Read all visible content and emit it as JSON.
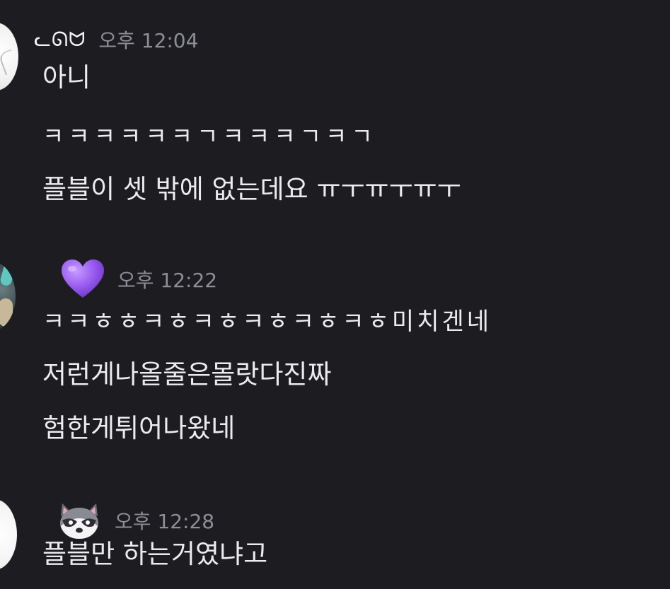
{
  "messages": [
    {
      "author": "ᓚᘏᗢ",
      "time": "오후 12:04",
      "lines": [
        "아니",
        "ㅋㅋㅋㅋㅋㅋㄱㅋㅋㅋㄱㅋㄱ",
        "플블이 셋 밖에 없는데요 ㅠㅜㅠㅜㅠㅜ"
      ]
    },
    {
      "author_icon": "purple-heart-icon",
      "time": "오후 12:22",
      "lines": [
        "ㅋㅋㅎㅎㅋㅎㅋㅎㅋㅎㅋㅎㅋㅎ미치겐네",
        "저런게나올줄은몰랏다진짜",
        "험한게튀어나왔네"
      ]
    },
    {
      "author_icon": "raccoon-face-icon",
      "time": "오후 12:28",
      "lines": [
        "플블만 하는거였냐고"
      ]
    }
  ],
  "colors": {
    "background": "#1c1c21",
    "text": "#ececef",
    "timestamp": "#8e8e97",
    "heart": "#a66cf2"
  }
}
